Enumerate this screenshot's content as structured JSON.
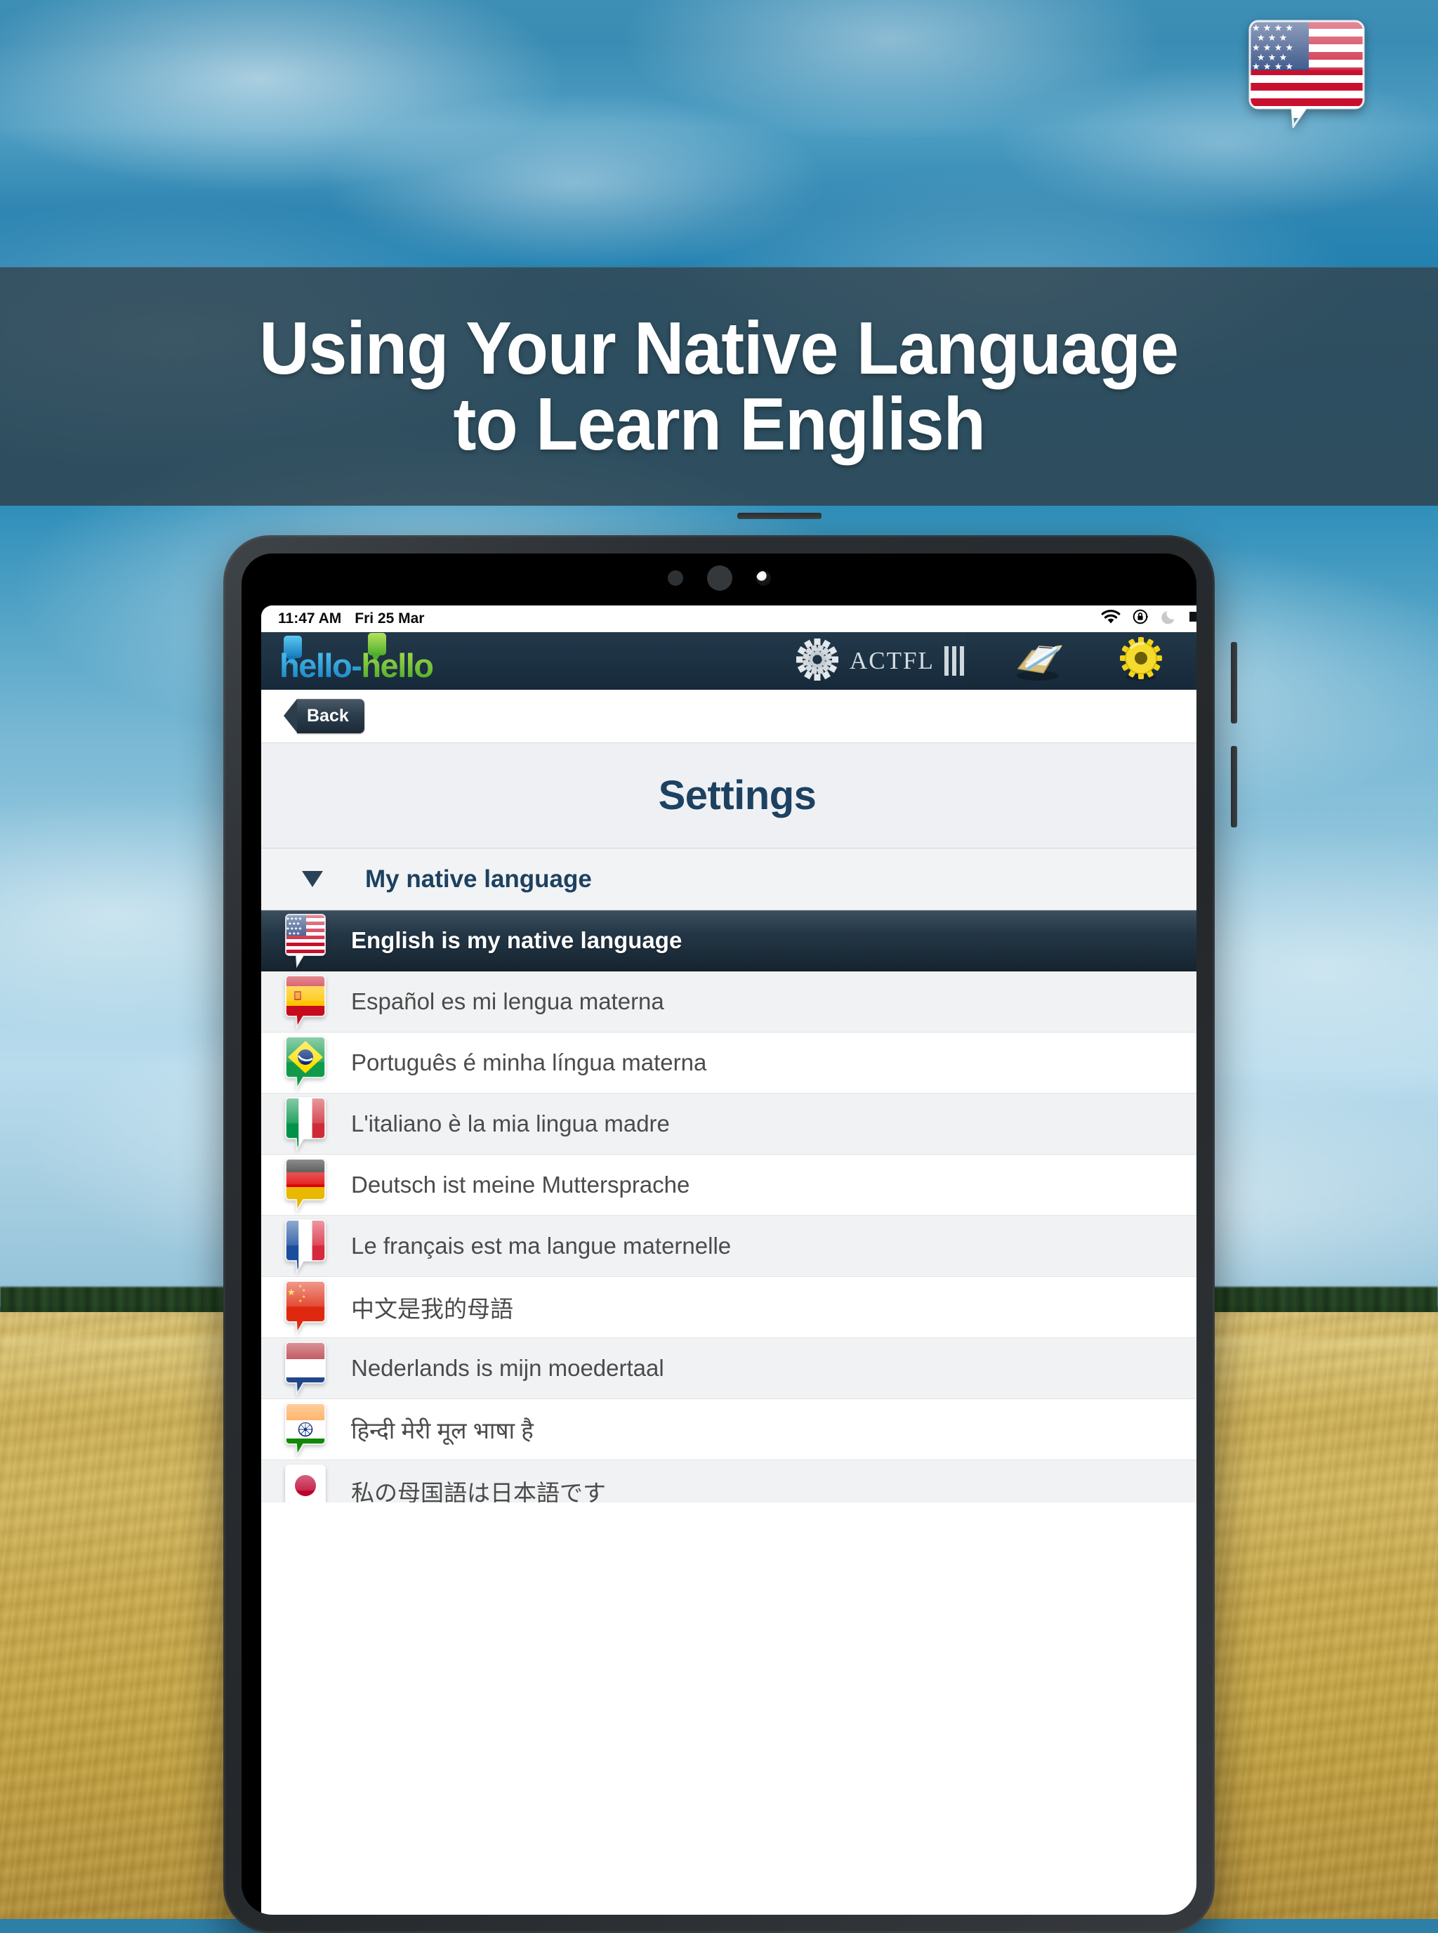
{
  "promo": {
    "headline_line1": "Using Your Native Language",
    "headline_line2": "to Learn English",
    "flag_pin_icon": "us-flag-pin-icon"
  },
  "device": {
    "sensors": [
      "proximity-sensor",
      "ambient-light-sensor",
      "front-camera"
    ],
    "buttons": [
      "volume-up-button",
      "volume-down-button",
      "power-button"
    ]
  },
  "statusbar": {
    "time": "11:47 AM",
    "date": "Fri 25 Mar",
    "icons": [
      "wifi-icon",
      "rotation-lock-icon",
      "do-not-disturb-moon-icon",
      "battery-icon"
    ]
  },
  "navbar": {
    "logo_part1": "hello",
    "logo_dash": "-",
    "logo_part2": "hello",
    "actfl_label": "ACTFL",
    "icons": [
      "notebook-pencil-icon",
      "gear-icon"
    ]
  },
  "toolbar": {
    "back_label": "Back"
  },
  "page": {
    "title": "Settings"
  },
  "section": {
    "label": "My native language",
    "expanded": true
  },
  "languages": [
    {
      "label": "English is my native language",
      "flag": "us-flag-pin-icon",
      "selected": true
    },
    {
      "label": "Español es mi lengua materna",
      "flag": "spain-flag-pin-icon",
      "selected": false
    },
    {
      "label": "Português é minha língua materna",
      "flag": "brazil-flag-pin-icon",
      "selected": false
    },
    {
      "label": "L'italiano è la mia lingua madre",
      "flag": "italy-flag-pin-icon",
      "selected": false
    },
    {
      "label": "Deutsch ist meine Muttersprache",
      "flag": "germany-flag-pin-icon",
      "selected": false
    },
    {
      "label": "Le français est ma langue maternelle",
      "flag": "france-flag-pin-icon",
      "selected": false
    },
    {
      "label": "中文是我的母語",
      "flag": "china-flag-pin-icon",
      "selected": false
    },
    {
      "label": "Nederlands is mijn moedertaal",
      "flag": "netherlands-flag-pin-icon",
      "selected": false
    },
    {
      "label": "हिन्दी मेरी मूल भाषा है",
      "flag": "india-flag-pin-icon",
      "selected": false
    },
    {
      "label": "私の母国語は日本語です",
      "flag": "japan-flag-pin-icon",
      "selected": false
    }
  ],
  "colors": {
    "brand_navy": "#1d4161",
    "navbar_dark": "#1d3243",
    "logo_blue": "#2a9fd8",
    "logo_green": "#6fbf3a",
    "selected_row": "#243747",
    "row_alt": "#f1f2f3",
    "headline_overlay": "rgba(52,68,78,0.80)"
  }
}
